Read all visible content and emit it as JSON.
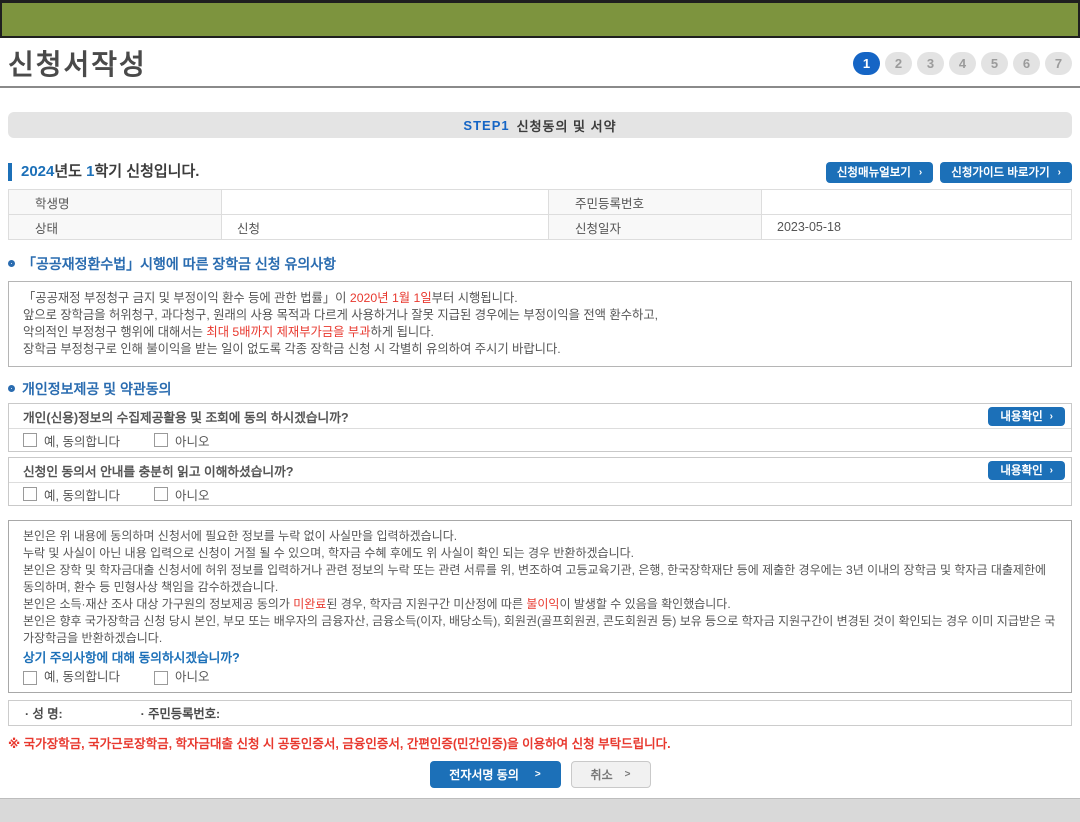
{
  "colors": {
    "top_banner_green": "#7d943e",
    "accent_blue": "#1c70b8",
    "step_active_blue": "#1565c5",
    "warning_red": "#e8392f"
  },
  "page": {
    "title": "신청서작성"
  },
  "steps": {
    "labels": [
      "1",
      "2",
      "3",
      "4",
      "5",
      "6",
      "7"
    ],
    "active": "1"
  },
  "step_banner": {
    "step_word": "STEP1",
    "label": "신청동의 및 서약"
  },
  "apply_section": {
    "year": "2024",
    "mid": "년도 ",
    "semester": "1",
    "rest": "학기 신청입니다.",
    "manual_button": "신청매뉴얼보기",
    "guide_button": "신청가이드 바로가기",
    "button_arrow": "›"
  },
  "info_table": {
    "rows": [
      {
        "label1": "학생명",
        "value1": "",
        "label2": "주민등록번호",
        "value2": ""
      },
      {
        "label1": "상태",
        "value1": "신청",
        "label2": "신청일자",
        "value2": "2023-05-18"
      }
    ]
  },
  "notice_section": {
    "title": "「공공재정환수법」시행에 따른 장학금 신청 유의사항",
    "line1_a": "「공공재정 부정청구 금지 및 부정이익 환수 등에 관한 법률」이 ",
    "line1_red": "2020년 1월 1일",
    "line1_b": "부터 시행됩니다.",
    "line2": "앞으로 장학금을 허위청구, 과다청구, 원래의 사용 목적과 다르게 사용하거나 잘못 지급된 경우에는 부정이익을 전액 환수하고,",
    "line3_a": "악의적인 부정청구 행위에 대해서는 ",
    "line3_red": "최대 5배까지 제재부가금을 부과",
    "line3_b": "하게 됩니다.",
    "line4": "장학금 부정청구로 인해 불이익을 받는 일이 없도록 각종 장학금 신청 시 각별히 유의하여 주시기 바랍니다."
  },
  "consent_section": {
    "title": "개인정보제공 및 약관동의",
    "confirm_button": "내용확인",
    "confirm_arrow": "›",
    "items": [
      {
        "question": "개인(신용)정보의 수집제공활용 및 조회에 동의 하시겠습니까?",
        "yes": "예, 동의합니다",
        "no": "아니오"
      },
      {
        "question": "신청인 동의서 안내를 충분히 읽고 이해하셨습니까?",
        "yes": "예, 동의합니다",
        "no": "아니오"
      }
    ]
  },
  "pledge": {
    "line1": "본인은 위 내용에 동의하며 신청서에 필요한 정보를 누락 없이 사실만을 입력하겠습니다.",
    "line2": "누락 및 사실이 아닌 내용 입력으로 신청이 거절 될 수 있으며, 학자금 수혜 후에도 위 사실이 확인 되는 경우 반환하겠습니다.",
    "line3": "본인은 장학 및 학자금대출 신청서에 허위 정보를 입력하거나 관련 정보의 누락 또는 관련 서류를 위, 변조하여 고등교육기관, 은행, 한국장학재단 등에 제출한 경우에는 3년 이내의 장학금 및 학자금 대출제한에 동의하며, 환수 등 민형사상 책임을 감수하겠습니다.",
    "line4_a": "본인은 소득·재산 조사 대상 가구원의 정보제공 동의가 ",
    "line4_red1": "미완료",
    "line4_b": "된 경우, 학자금 지원구간 미산정에 따른 ",
    "line4_red2": "불이익",
    "line4_c": "이 발생할 수 있음을 확인했습니다.",
    "line5": "본인은 향후 국가장학금 신청 당시 본인, 부모 또는 배우자의 금융자산, 금융소득(이자, 배당소득), 회원권(골프회원권, 콘도회원권 등) 보유 등으로 학자금 지원구간이 변경된 것이 확인되는 경우 이미 지급받은 국가장학금을 반환하겠습니다.",
    "question": "상기 주의사항에 대해 동의하시겠습니까?",
    "yes": "예, 동의합니다",
    "no": "아니오"
  },
  "signature": {
    "name_label": "· 성 명:",
    "rrn_label": "· 주민등록번호:"
  },
  "footer": {
    "note": "※ 국가장학금, 국가근로장학금, 학자금대출 신청 시 공동인증서, 금융인증서, 간편인증(민간인증)을 이용하여 신청 부탁드립니다.",
    "sign_button": "전자서명 동의",
    "cancel_button": "취소",
    "button_arrow": ">"
  }
}
